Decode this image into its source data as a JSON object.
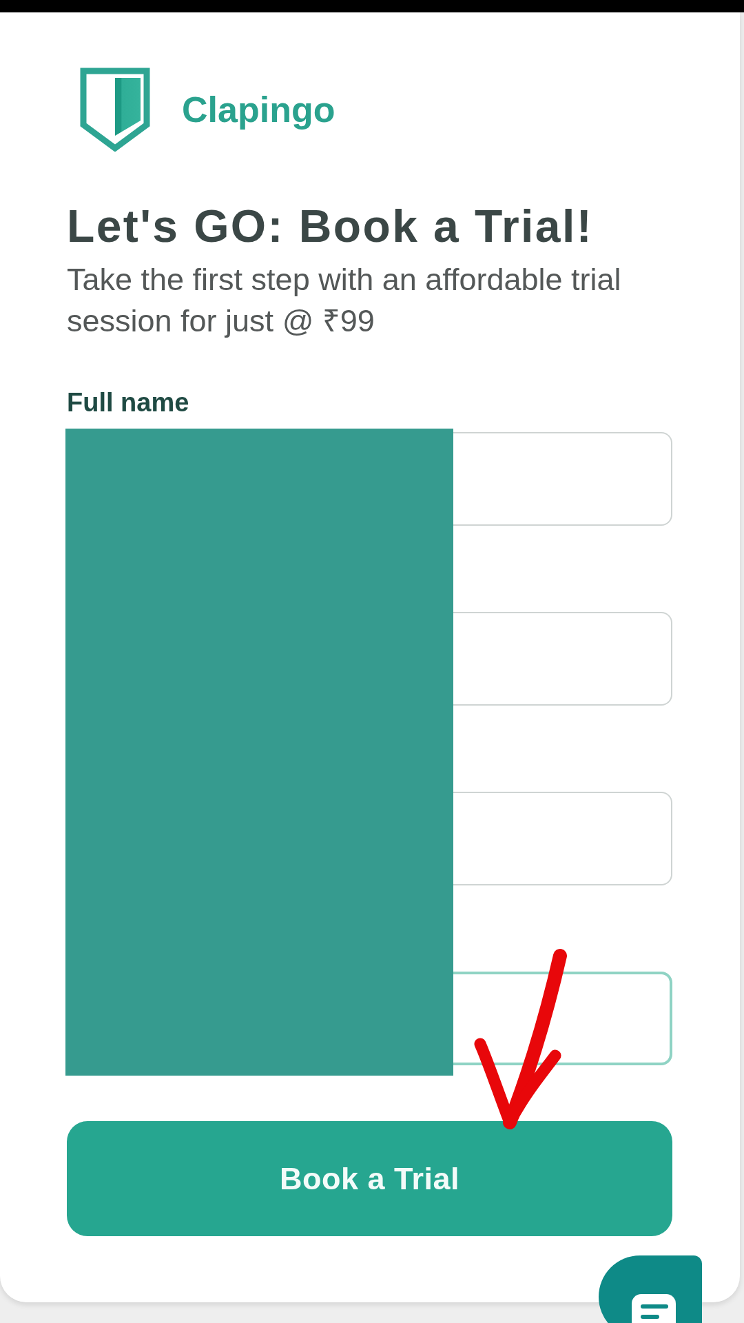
{
  "brand": {
    "name": "Clapingo"
  },
  "heading": "Let's GO: Book a Trial!",
  "subtitle": "Take the first step with an affordable trial session for just @ ₹99",
  "fields": [
    {
      "label": "Full name",
      "focused": false
    },
    {
      "focused": false
    },
    {
      "focused": false
    },
    {
      "focused": true
    }
  ],
  "submit_button": {
    "label": "Book a Trial"
  }
}
